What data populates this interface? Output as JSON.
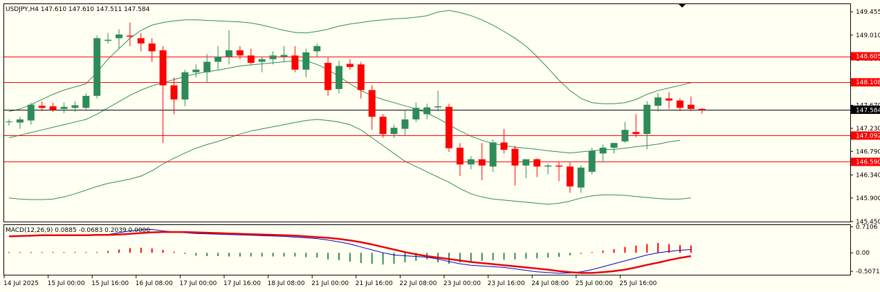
{
  "header": {
    "symbol": "USDJPY,H4",
    "ohlc": "147.610 147.610 147.511 147.584"
  },
  "macd_header": "MACD(12,26,9) 0.0885 -0.0683 0.2039 0.0000",
  "colors": {
    "bull": "#2e8b57",
    "bear": "#ff0000",
    "band": "#2e8b57",
    "hline": "#ff0000",
    "macd_signal": "#e8000b",
    "macd_line": "#0000c8",
    "price_tag": "#ff0000"
  },
  "chart_data": [
    {
      "type": "candlestick",
      "title": "USDJPY,H4",
      "x_ticks": [
        "14 Jul 2025",
        "15 Jul 00:00",
        "15 Jul 16:00",
        "16 Jul 08:00",
        "17 Jul 00:00",
        "17 Jul 16:00",
        "18 Jul 08:00",
        "21 Jul 00:00",
        "21 Jul 16:00",
        "22 Jul 08:00",
        "23 Jul 00:00",
        "23 Jul 16:00",
        "24 Jul 08:00",
        "25 Jul 00:00",
        "25 Jul 16:00"
      ],
      "y_ticks": [
        "149.455",
        "149.010",
        "148.560",
        "147.670",
        "147.230",
        "146.790",
        "146.340",
        "145.900",
        "145.450"
      ],
      "ylim": [
        145.45,
        149.6
      ],
      "current_price": "147.584",
      "horizontal_levels": [
        "148.605",
        "148.108",
        "147.092",
        "146.590"
      ],
      "candles": [
        [
          147.35,
          147.4,
          147.28,
          147.36
        ],
        [
          147.34,
          147.45,
          147.22,
          147.4
        ],
        [
          147.38,
          147.72,
          147.3,
          147.68
        ],
        [
          147.66,
          147.74,
          147.56,
          147.62
        ],
        [
          147.65,
          147.72,
          147.54,
          147.58
        ],
        [
          147.6,
          147.72,
          147.52,
          147.64
        ],
        [
          147.62,
          147.75,
          147.54,
          147.67
        ],
        [
          147.62,
          147.9,
          147.58,
          147.85
        ],
        [
          147.85,
          149.0,
          147.8,
          148.95
        ],
        [
          148.9,
          149.05,
          148.85,
          148.92
        ],
        [
          148.95,
          149.12,
          148.75,
          149.02
        ],
        [
          149.0,
          149.25,
          148.8,
          148.98
        ],
        [
          148.95,
          149.05,
          148.7,
          148.85
        ],
        [
          148.85,
          148.95,
          148.5,
          148.7
        ],
        [
          148.72,
          148.8,
          146.95,
          148.05
        ],
        [
          148.05,
          148.2,
          147.5,
          147.78
        ],
        [
          147.78,
          148.35,
          147.65,
          148.3
        ],
        [
          148.3,
          148.45,
          148.2,
          148.35
        ],
        [
          148.3,
          148.65,
          148.1,
          148.5
        ],
        [
          148.5,
          148.8,
          148.35,
          148.6
        ],
        [
          148.6,
          149.1,
          148.45,
          148.72
        ],
        [
          148.72,
          148.8,
          148.55,
          148.62
        ],
        [
          148.62,
          148.75,
          148.45,
          148.48
        ],
        [
          148.5,
          148.6,
          148.3,
          148.55
        ],
        [
          148.55,
          148.7,
          148.45,
          148.62
        ],
        [
          148.6,
          148.8,
          148.5,
          148.63
        ],
        [
          148.62,
          148.8,
          148.3,
          148.35
        ],
        [
          148.35,
          148.75,
          148.2,
          148.68
        ],
        [
          148.7,
          148.85,
          148.6,
          148.8
        ],
        [
          148.48,
          148.58,
          147.85,
          147.96
        ],
        [
          147.98,
          148.52,
          147.9,
          148.42
        ],
        [
          148.46,
          148.55,
          148.35,
          148.4
        ],
        [
          148.45,
          148.5,
          147.8,
          147.96
        ],
        [
          147.96,
          148.05,
          147.2,
          147.45
        ],
        [
          147.45,
          147.5,
          147.05,
          147.12
        ],
        [
          147.12,
          147.3,
          147.05,
          147.24
        ],
        [
          147.22,
          147.58,
          147.1,
          147.4
        ],
        [
          147.4,
          147.72,
          147.35,
          147.62
        ],
        [
          147.5,
          147.7,
          147.4,
          147.63
        ],
        [
          147.63,
          147.95,
          147.55,
          147.65
        ],
        [
          147.64,
          147.7,
          146.78,
          146.85
        ],
        [
          146.86,
          146.95,
          146.32,
          146.54
        ],
        [
          146.54,
          146.7,
          146.45,
          146.64
        ],
        [
          146.64,
          146.95,
          146.24,
          146.52
        ],
        [
          146.5,
          147.02,
          146.4,
          146.96
        ],
        [
          146.96,
          147.22,
          146.75,
          146.82
        ],
        [
          146.84,
          146.9,
          146.14,
          146.52
        ],
        [
          146.52,
          146.62,
          146.28,
          146.64
        ],
        [
          146.64,
          146.66,
          146.3,
          146.5
        ],
        [
          146.5,
          146.56,
          146.35,
          146.52
        ],
        [
          146.52,
          146.58,
          146.22,
          146.5
        ],
        [
          146.5,
          146.58,
          146.0,
          146.12
        ],
        [
          146.1,
          146.52,
          146.0,
          146.48
        ],
        [
          146.4,
          146.86,
          146.35,
          146.8
        ],
        [
          146.75,
          146.92,
          146.58,
          146.86
        ],
        [
          146.86,
          146.95,
          146.75,
          146.95
        ],
        [
          146.98,
          147.35,
          146.95,
          147.2
        ],
        [
          147.16,
          147.5,
          147.06,
          147.12
        ],
        [
          147.12,
          147.75,
          146.83,
          147.68
        ],
        [
          147.66,
          147.9,
          147.55,
          147.82
        ],
        [
          147.8,
          147.92,
          147.6,
          147.76
        ],
        [
          147.76,
          147.8,
          147.56,
          147.62
        ],
        [
          147.68,
          147.84,
          147.56,
          147.6
        ],
        [
          147.6,
          147.62,
          147.51,
          147.58
        ]
      ],
      "upper_band": [
        147.55,
        147.6,
        147.68,
        147.78,
        147.88,
        147.96,
        148.02,
        148.08,
        148.3,
        148.55,
        148.75,
        148.95,
        149.1,
        149.2,
        149.25,
        149.28,
        149.3,
        149.3,
        149.29,
        149.28,
        149.27,
        149.26,
        149.24,
        149.2,
        149.15,
        149.1,
        149.06,
        149.05,
        149.08,
        149.12,
        149.18,
        149.22,
        149.25,
        149.28,
        149.3,
        149.32,
        149.33,
        149.35,
        149.38,
        149.45,
        149.48,
        149.44,
        149.38,
        149.3,
        149.2,
        149.08,
        148.95,
        148.8,
        148.6,
        148.38,
        148.15,
        147.95,
        147.8,
        147.72,
        147.7,
        147.7,
        147.72,
        147.78,
        147.88,
        147.95,
        148.0,
        148.05,
        148.1
      ],
      "middle_band": [
        147.05,
        147.1,
        147.15,
        147.2,
        147.25,
        147.3,
        147.35,
        147.4,
        147.5,
        147.62,
        147.74,
        147.86,
        147.96,
        148.04,
        148.1,
        148.16,
        148.22,
        148.27,
        148.31,
        148.34,
        148.38,
        148.42,
        148.44,
        148.46,
        148.48,
        148.5,
        148.52,
        148.52,
        148.45,
        148.35,
        148.22,
        148.08,
        147.95,
        147.85,
        147.78,
        147.72,
        147.66,
        147.6,
        147.52,
        147.42,
        147.3,
        147.18,
        147.08,
        147.0,
        146.94,
        146.9,
        146.87,
        146.85,
        146.83,
        146.8,
        146.78,
        146.76,
        146.78,
        146.8,
        146.82,
        146.83,
        146.85,
        146.88,
        146.9,
        146.93,
        146.97,
        147.0
      ],
      "lower_band": [
        145.9,
        145.88,
        145.87,
        145.87,
        145.88,
        145.92,
        145.98,
        146.05,
        146.12,
        146.18,
        146.22,
        146.26,
        146.32,
        146.42,
        146.55,
        146.66,
        146.76,
        146.85,
        146.92,
        146.98,
        147.05,
        147.12,
        147.18,
        147.22,
        147.26,
        147.3,
        147.34,
        147.38,
        147.4,
        147.38,
        147.35,
        147.3,
        147.2,
        147.05,
        146.9,
        146.75,
        146.6,
        146.5,
        146.4,
        146.3,
        146.2,
        146.08,
        145.98,
        145.92,
        145.88,
        145.86,
        145.84,
        145.82,
        145.8,
        145.78,
        145.8,
        145.84,
        145.9,
        145.94,
        145.96,
        145.96,
        145.95,
        145.93,
        145.91,
        145.89,
        145.88,
        145.88,
        145.9
      ]
    },
    {
      "type": "bar",
      "title": "MACD(12,26,9) 0.0885 -0.0683 0.2039 0.0000",
      "y_ticks": [
        "0.7106",
        "0.00",
        "-0.5071"
      ],
      "ylim": [
        -0.6,
        0.76
      ],
      "histogram": [
        0.02,
        0.02,
        0.02,
        0.02,
        0.02,
        0.02,
        0.02,
        0.02,
        0.02,
        0.05,
        0.09,
        0.13,
        0.14,
        0.12,
        0.08,
        0.03,
        -0.03,
        -0.08,
        -0.09,
        -0.09,
        -0.1,
        -0.1,
        -0.1,
        -0.1,
        -0.1,
        -0.1,
        -0.1,
        -0.12,
        -0.13,
        -0.18,
        -0.2,
        -0.24,
        -0.28,
        -0.3,
        -0.32,
        -0.3,
        -0.26,
        -0.22,
        -0.18,
        -0.26,
        -0.3,
        -0.26,
        -0.25,
        -0.22,
        -0.2,
        -0.19,
        -0.18,
        -0.16,
        -0.15,
        -0.13,
        -0.11,
        -0.07,
        -0.03,
        0.02,
        0.06,
        0.1,
        0.16,
        0.2,
        0.24,
        0.27,
        0.24,
        0.21,
        0.2
      ],
      "macd_line": [
        0.45,
        0.46,
        0.47,
        0.48,
        0.48,
        0.48,
        0.48,
        0.48,
        0.48,
        0.5,
        0.55,
        0.6,
        0.63,
        0.64,
        0.6,
        0.57,
        0.55,
        0.53,
        0.52,
        0.51,
        0.5,
        0.49,
        0.48,
        0.47,
        0.46,
        0.45,
        0.43,
        0.41,
        0.39,
        0.35,
        0.3,
        0.24,
        0.16,
        0.08,
        0.0,
        -0.06,
        -0.08,
        -0.1,
        -0.12,
        -0.17,
        -0.24,
        -0.3,
        -0.34,
        -0.36,
        -0.38,
        -0.4,
        -0.44,
        -0.48,
        -0.52,
        -0.54,
        -0.56,
        -0.55,
        -0.52,
        -0.46,
        -0.38,
        -0.3,
        -0.22,
        -0.14,
        -0.06,
        0.0,
        0.04,
        0.07,
        0.09
      ],
      "signal_line": [
        0.45,
        0.46,
        0.47,
        0.48,
        0.48,
        0.48,
        0.48,
        0.48,
        0.49,
        0.49,
        0.5,
        0.52,
        0.54,
        0.56,
        0.57,
        0.57,
        0.57,
        0.56,
        0.55,
        0.54,
        0.53,
        0.52,
        0.51,
        0.5,
        0.49,
        0.48,
        0.47,
        0.45,
        0.43,
        0.41,
        0.38,
        0.34,
        0.29,
        0.23,
        0.16,
        0.09,
        0.02,
        -0.04,
        -0.09,
        -0.13,
        -0.17,
        -0.21,
        -0.25,
        -0.28,
        -0.31,
        -0.34,
        -0.37,
        -0.4,
        -0.43,
        -0.46,
        -0.5,
        -0.53,
        -0.55,
        -0.55,
        -0.53,
        -0.5,
        -0.46,
        -0.4,
        -0.33,
        -0.27,
        -0.2,
        -0.14,
        -0.09
      ]
    }
  ]
}
